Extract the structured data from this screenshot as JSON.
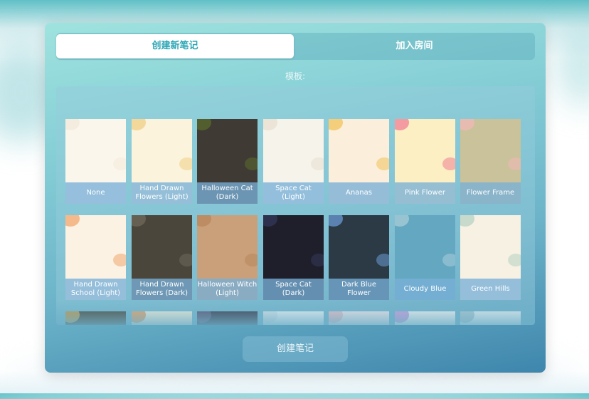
{
  "tabs": {
    "create_note": "创建新笔记",
    "join_room": "加入房间"
  },
  "templates_label": "模板:",
  "templates": [
    {
      "name": "None",
      "icon": "blank-paper",
      "bg": "#fbf6ec",
      "deco": "#f2eadb"
    },
    {
      "name": "Hand Drawn Flowers (Light)",
      "icon": "flowers-light",
      "bg": "#fbf3dc",
      "deco": "#f0cf86"
    },
    {
      "name": "Halloween Cat (Dark)",
      "icon": "halloween-cat",
      "bg": "#3f3a33",
      "deco": "#5b6b2e"
    },
    {
      "name": "Space Cat (Light)",
      "icon": "space-cat",
      "bg": "#f6f3ea",
      "deco": "#e7dfd0"
    },
    {
      "name": "Ananas",
      "icon": "pineapple",
      "bg": "#fbeedb",
      "deco": "#f1c35a"
    },
    {
      "name": "Pink Flower",
      "icon": "pink-flower",
      "bg": "#fbefc3",
      "deco": "#f07f94"
    },
    {
      "name": "Flower Frame",
      "icon": "flower-frame",
      "bg": "#c9c29a",
      "deco": "#f2b8b8"
    },
    {
      "name": "Hand Drawn School (Light)",
      "icon": "school-light",
      "bg": "#fbf2e4",
      "deco": "#f1a76e"
    },
    {
      "name": "Hand Drawn Flowers (Dark)",
      "icon": "flowers-dark",
      "bg": "#4b463b",
      "deco": "#6f6a5c"
    },
    {
      "name": "Halloween Witch (Light)",
      "icon": "witch",
      "bg": "#caa07a",
      "deco": "#b8865b"
    },
    {
      "name": "Space Cat (Dark)",
      "icon": "space-cat-dark",
      "bg": "#1f1f2c",
      "deco": "#34385a"
    },
    {
      "name": "Dark Blue Flower",
      "icon": "blue-flower",
      "bg": "#2b3a44",
      "deco": "#6b9ad3"
    },
    {
      "name": "Cloudy Blue",
      "icon": "cloud",
      "bg": "#63a7c0",
      "deco": "#a9cdd8"
    },
    {
      "name": "Green Hills",
      "icon": "hills",
      "bg": "#f7f1e3",
      "deco": "#b7d1c3"
    },
    {
      "name": "",
      "icon": "autumn",
      "bg": "#4d4638",
      "deco": "#f0b34a"
    },
    {
      "name": "",
      "icon": "orange-floral",
      "bg": "#fbf1da",
      "deco": "#f18a3a"
    },
    {
      "name": "",
      "icon": "purple-night",
      "bg": "#3b3342",
      "deco": "#6a5a7a"
    },
    {
      "name": "",
      "icon": "snowflake",
      "bg": "#f3f5f6",
      "deco": "#d9e1e6"
    },
    {
      "name": "",
      "icon": "rose-frame",
      "bg": "#fbeaea",
      "deco": "#f3b0b8"
    },
    {
      "name": "",
      "icon": "rainbow-drip",
      "bg": "#fbf7f2",
      "deco": "#c97fd6"
    },
    {
      "name": "",
      "icon": "blue-watercolor",
      "bg": "#eef2f2",
      "deco": "#9db9c2"
    }
  ],
  "create_button": "创建笔记"
}
